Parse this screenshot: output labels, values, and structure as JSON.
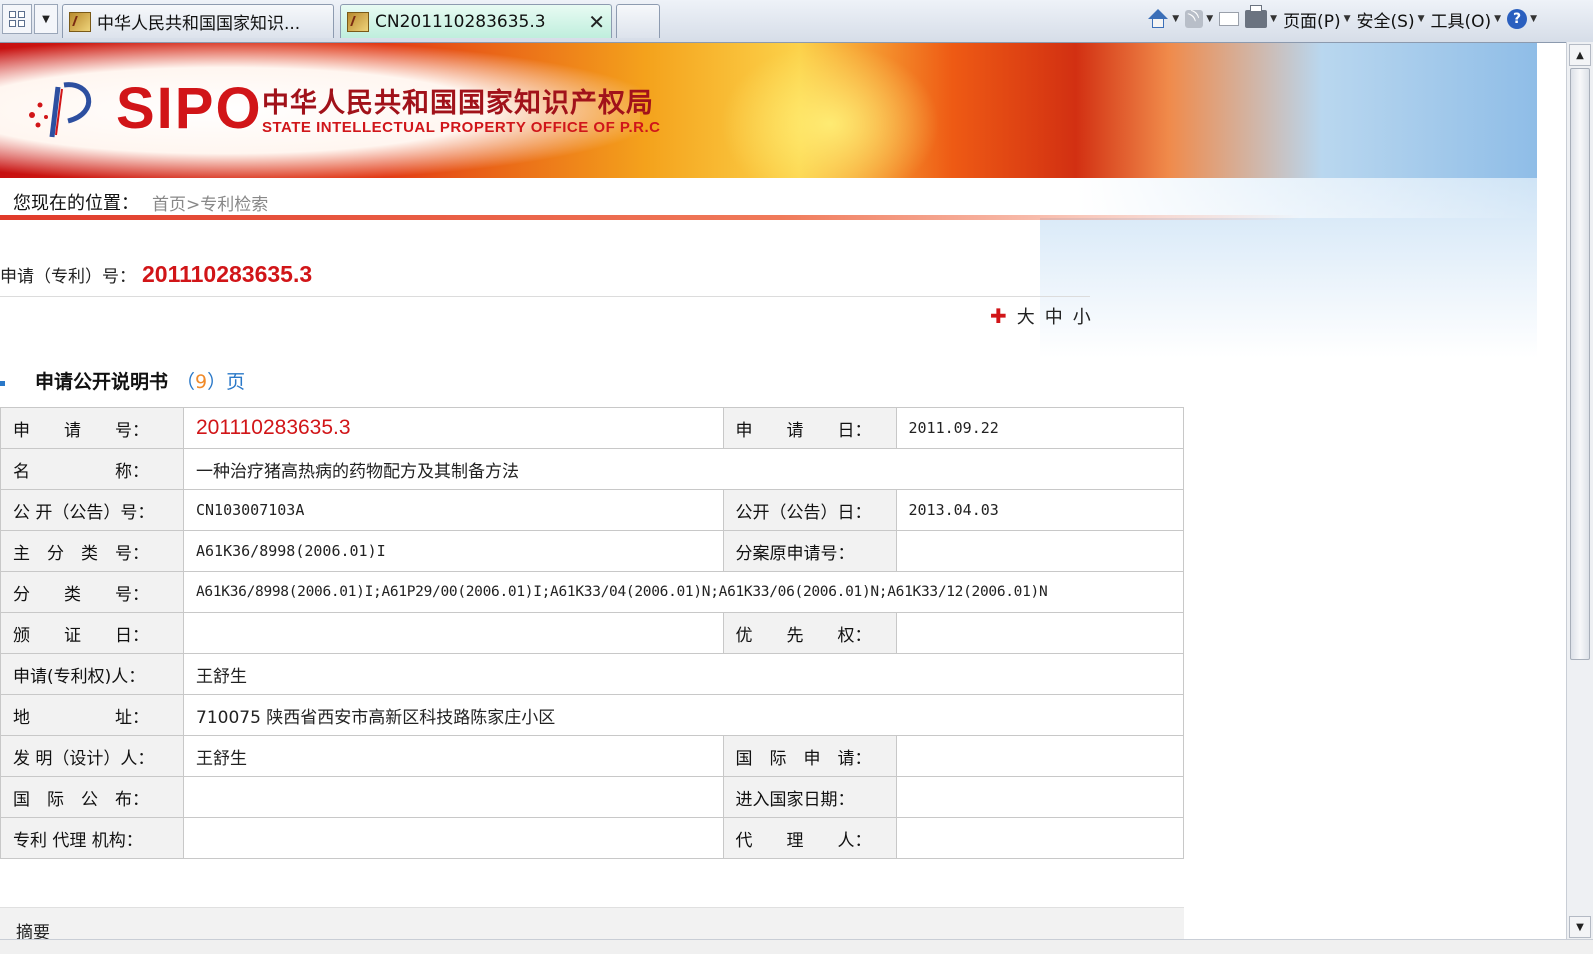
{
  "browser": {
    "tabs": [
      {
        "label": "中华人民共和国国家知识..."
      },
      {
        "label": "CN201110283635.3"
      }
    ],
    "close_glyph": "✕",
    "menu": {
      "page": "页面(P)",
      "safety": "安全(S)",
      "tools": "工具(O)"
    },
    "icons": [
      "home-icon",
      "feed-icon",
      "read-mail-icon",
      "print-icon",
      "help-icon"
    ]
  },
  "banner": {
    "logo_text": "SIPO",
    "name_cn": "中华人民共和国国家知识产权局",
    "name_en": "STATE INTELLECTUAL PROPERTY OFFICE OF P.R.C"
  },
  "breadcrumb": {
    "label": "您现在的位置：",
    "path": "首页>专利检索"
  },
  "application": {
    "label": "申请（专利）号：",
    "number": "201110283635.3"
  },
  "font_size_controls": {
    "large": "大",
    "medium": "中",
    "small": "小"
  },
  "section": {
    "title": "申请公开说明书",
    "pages_open": "（",
    "pages_count": "9",
    "pages_close": "）页"
  },
  "table": {
    "r1": {
      "l1": "申　　请　　号：",
      "v1": "201110283635.3",
      "l2": "申　　请　　日：",
      "v2": "2011.09.22"
    },
    "r2": {
      "l1": "名　　　　　称：",
      "v1": "一种治疗猪高热病的药物配方及其制备方法"
    },
    "r3": {
      "l1": "公 开（公告）号：",
      "v1": "CN103007103A",
      "l2": "公开（公告）日：",
      "v2": "2013.04.03"
    },
    "r4": {
      "l1": "主　分　类　号：",
      "v1": "A61K36/8998(2006.01)I",
      "l2": "分案原申请号：",
      "v2": ""
    },
    "r5": {
      "l1": "分　　类　　号：",
      "v1": "A61K36/8998(2006.01)I;A61P29/00(2006.01)I;A61K33/04(2006.01)N;A61K33/06(2006.01)N;A61K33/12(2006.01)N"
    },
    "r6": {
      "l1": "颁　　证　　日：",
      "v1": "",
      "l2": "优　　先　　权：",
      "v2": ""
    },
    "r7": {
      "l1": "申请(专利权)人：",
      "v1": "王舒生"
    },
    "r8": {
      "l1": "地　　　　　址：",
      "v1": "710075 陕西省西安市高新区科技路陈家庄小区"
    },
    "r9": {
      "l1": "发 明（设计）人：",
      "v1": "王舒生",
      "l2": "国　际　申　请：",
      "v2": ""
    },
    "r10": {
      "l1": "国　际　公　布：",
      "v1": "",
      "l2": "进入国家日期：",
      "v2": ""
    },
    "r11": {
      "l1": "专利 代理 机构：",
      "v1": "",
      "l2": "代　　理　　人：",
      "v2": ""
    }
  },
  "abstract": {
    "label": "摘要"
  },
  "colors": {
    "accent_red": "#d11518",
    "link_blue": "#2a78c8",
    "page_count_orange": "#f08a2a"
  }
}
